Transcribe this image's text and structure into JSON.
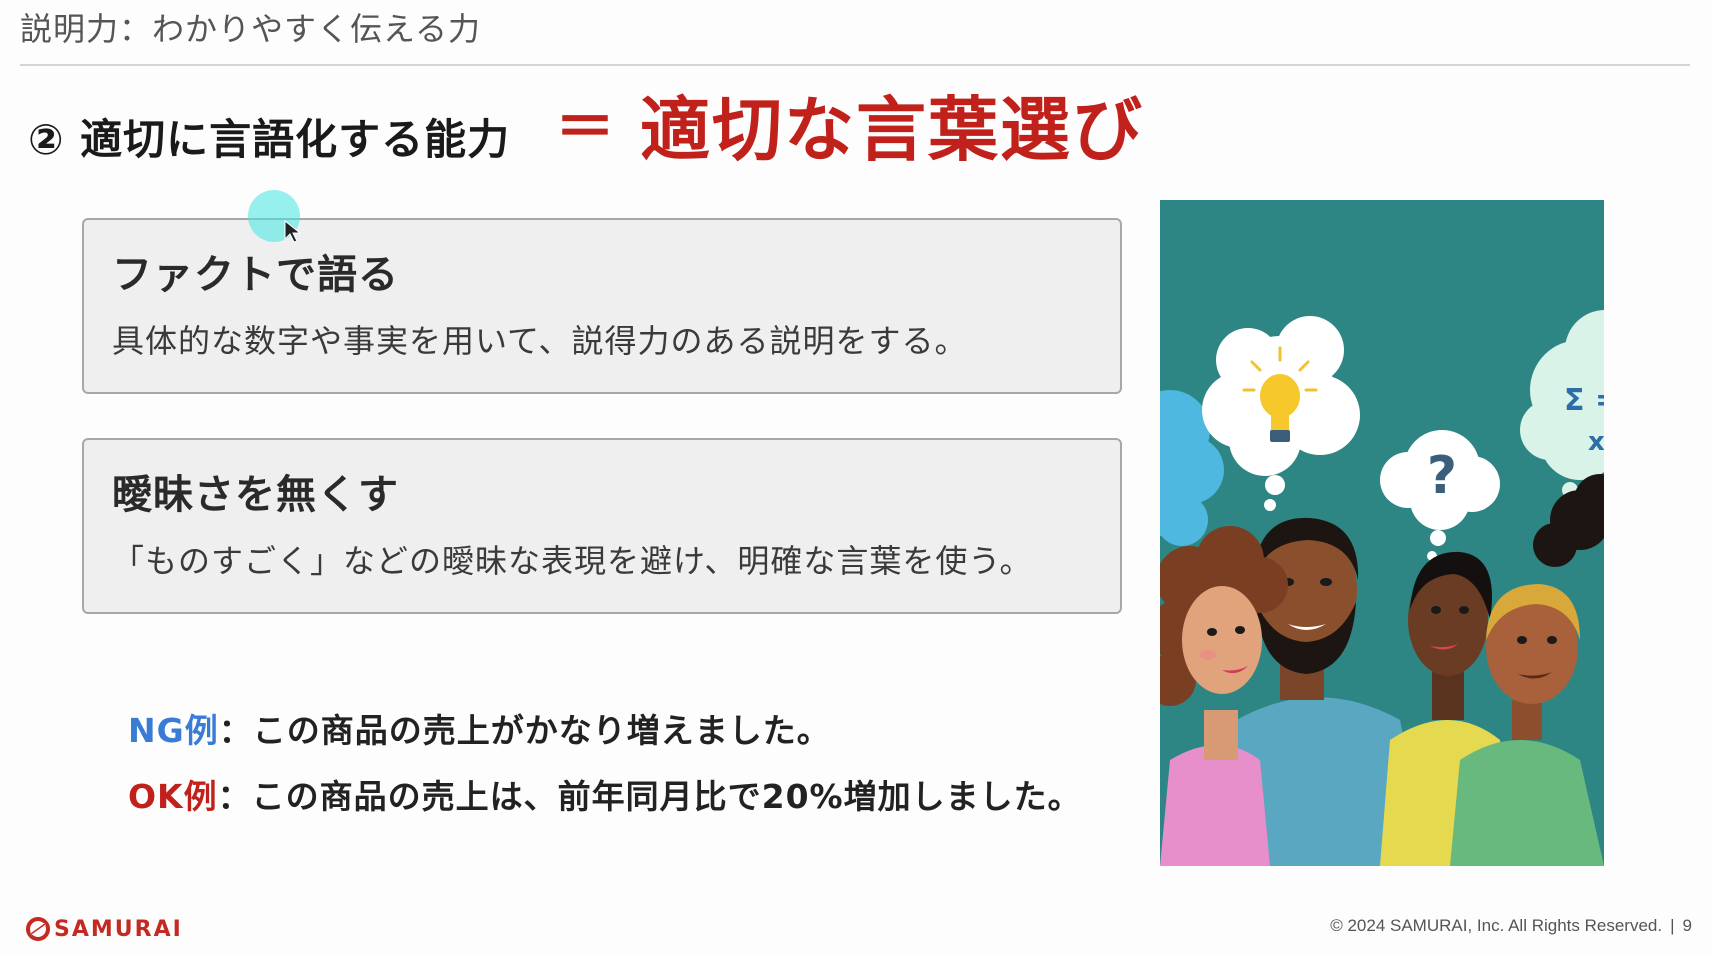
{
  "header": {
    "title": "説明力：わかりやすく伝える力"
  },
  "slide": {
    "subtitle": "② 適切に言語化する能力",
    "equals": "＝",
    "highlight": "適切な言葉選び"
  },
  "cards": [
    {
      "title": "ファクトで語る",
      "description": "具体的な数字や事実を用いて、説得力のある説明をする。"
    },
    {
      "title": "曖昧さを無くす",
      "description": "「ものすごく」などの曖昧な表現を避け、明確な言葉を使う。"
    }
  ],
  "examples": {
    "ng": {
      "label": "NG例",
      "separator": "：",
      "text": "この商品の売上がかなり増えました。"
    },
    "ok": {
      "label": "OK例",
      "separator": "：",
      "text": "この商品の売上は、前年同月比で20%増加しました。"
    }
  },
  "illustration": {
    "bubble_question": "?",
    "bubble_math_1": "Σ =",
    "bubble_math_2": "x"
  },
  "footer": {
    "logo": "SAMURAI",
    "copyright": "© 2024 SAMURAI, Inc. All Rights Reserved.",
    "separator": "|",
    "page_number": "9"
  },
  "colors": {
    "accent_red": "#c0211b",
    "ng_blue": "#3a7bd5",
    "ok_red": "#c0211b",
    "illustration_bg": "#2e8684"
  }
}
